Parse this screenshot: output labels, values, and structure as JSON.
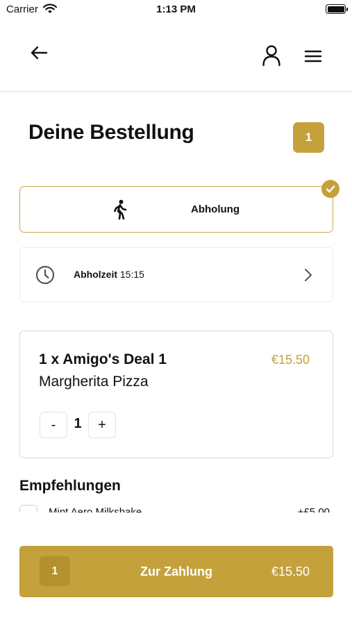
{
  "status_bar": {
    "carrier": "Carrier",
    "time": "1:13 PM"
  },
  "header": {
    "title": "Deine Bestellung",
    "cart_count": "1"
  },
  "pickup": {
    "label": "Abholung",
    "selected": true
  },
  "pickup_time": {
    "label": "Abholzeit",
    "time": "15:15"
  },
  "order_item": {
    "title": "1 x Amigo's Deal 1",
    "subtitle": "Margherita Pizza",
    "price": "€15.50",
    "minus": "-",
    "quantity": "1",
    "plus": "+"
  },
  "recommendations": {
    "title": "Empfehlungen",
    "items": [
      {
        "name": "Mint Aero Milkshake",
        "price": "+£5.00"
      }
    ]
  },
  "checkout": {
    "count": "1",
    "label": "Zur Zahlung",
    "total": "€15.50"
  },
  "colors": {
    "accent": "#c4a13b",
    "accent_dark": "#b3912f",
    "border": "#d7d7d7"
  },
  "icons": [
    "back-arrow-icon",
    "user-icon",
    "hamburger-menu-icon",
    "walking-person-icon",
    "check-icon",
    "clock-icon",
    "chevron-right-icon",
    "wifi-icon",
    "battery-icon"
  ]
}
